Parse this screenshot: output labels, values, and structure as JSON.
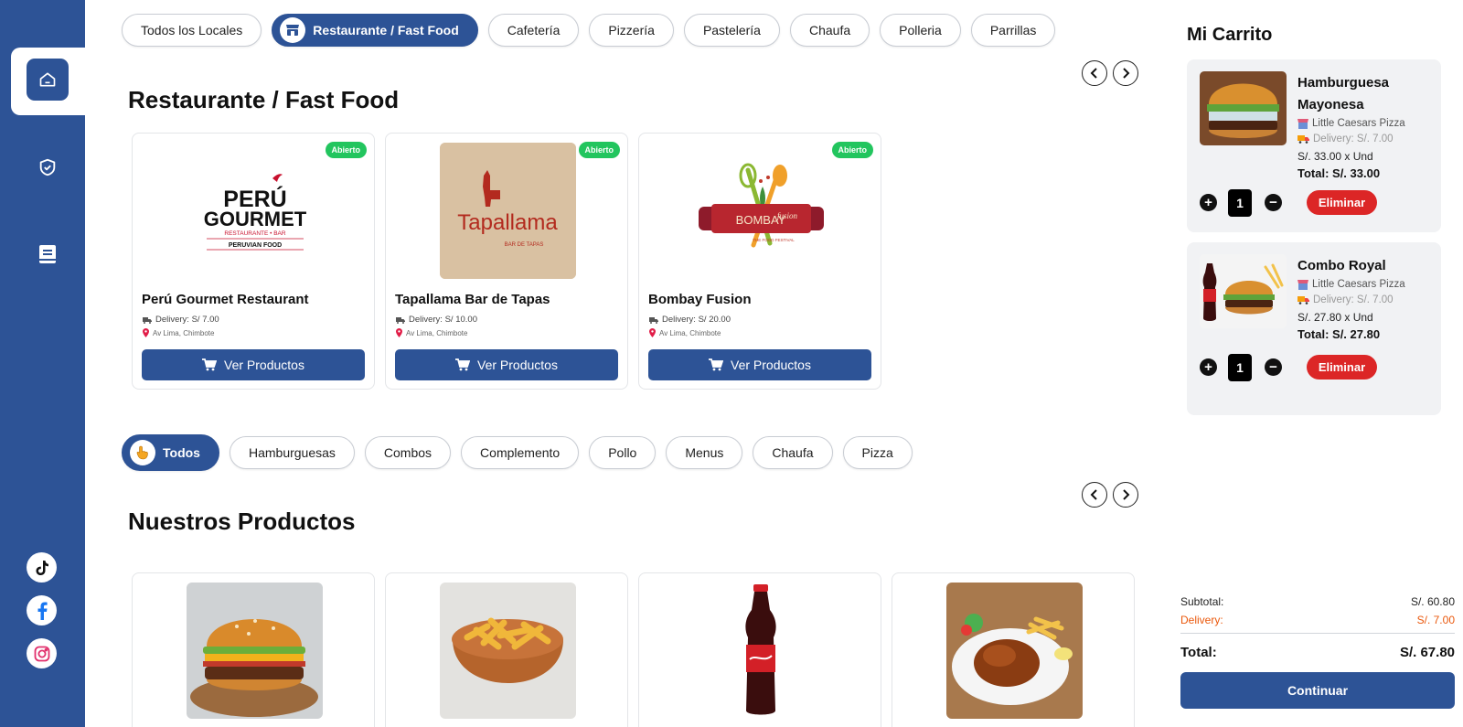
{
  "sidebar": {
    "nav": [
      {
        "icon": "home-icon"
      },
      {
        "icon": "shield-check-icon"
      },
      {
        "icon": "book-icon"
      }
    ],
    "social": [
      {
        "icon": "tiktok-icon"
      },
      {
        "icon": "facebook-icon",
        "color": "#1877f2"
      },
      {
        "icon": "instagram-icon",
        "color": "#e1306c"
      }
    ]
  },
  "store_filters": {
    "items": [
      "Todos los Locales",
      "Restaurante / Fast Food",
      "Cafetería",
      "Pizzería",
      "Pastelería",
      "Chaufa",
      "Polleria",
      "Parrillas"
    ],
    "active_index": 1
  },
  "stores_section": {
    "title": "Restaurante / Fast Food",
    "cards": [
      {
        "name": "Perú Gourmet Restaurant",
        "delivery": "Delivery: S/ 7.00",
        "address": "Av Lima, Chimbote",
        "status": "Abierto",
        "button": "Ver Productos",
        "logo": {
          "line1": "PERÚ",
          "line2": "GOURMET",
          "line3": "RESTAURANTE • BAR",
          "line4": "PERUVIAN FOOD"
        }
      },
      {
        "name": "Tapallama Bar de Tapas",
        "delivery": "Delivery: S/ 10.00",
        "address": "Av Lima, Chimbote",
        "status": "Abierto",
        "button": "Ver Productos",
        "logo": {
          "line1": "Tapallama",
          "line2": "BAR DE TAPAS"
        }
      },
      {
        "name": "Bombay Fusion",
        "delivery": "Delivery: S/ 20.00",
        "address": "Av Lima, Chimbote",
        "status": "Abierto",
        "button": "Ver Productos",
        "logo": {
          "line1": "BOMBAY",
          "line2": "fusion",
          "line3": "THE FOOD FESTIVAL"
        }
      }
    ]
  },
  "product_filters": {
    "items": [
      "Todos",
      "Hamburguesas",
      "Combos",
      "Complemento",
      "Pollo",
      "Menus",
      "Chaufa",
      "Pizza"
    ],
    "active_index": 0
  },
  "products_section": {
    "title": "Nuestros Productos",
    "cards": [
      {
        "image": "burger"
      },
      {
        "image": "fries"
      },
      {
        "image": "soda-bottle"
      },
      {
        "image": "roast-chicken"
      }
    ]
  },
  "cart": {
    "title": "Mi Carrito",
    "items": [
      {
        "name": "Hamburguesa Mayonesa",
        "store": "Little Caesars Pizza",
        "delivery": "Delivery: S/. 7.00",
        "unit_price": "S/. 33.00 x Und",
        "total": "Total: S/. 33.00",
        "qty": "1",
        "remove": "Eliminar"
      },
      {
        "name": "Combo Royal",
        "store": "Little Caesars Pizza",
        "delivery": "Delivery: S/. 7.00",
        "unit_price": "S/. 27.80 x Und",
        "total": "Total: S/. 27.80",
        "qty": "1",
        "remove": "Eliminar"
      }
    ],
    "summary": {
      "subtotal_label": "Subtotal:",
      "subtotal": "S/. 60.80",
      "delivery_label": "Delivery:",
      "delivery": "S/. 7.00",
      "total_label": "Total:",
      "total": "S/. 67.80",
      "continue": "Continuar"
    }
  },
  "colors": {
    "primary": "#2d5396",
    "open": "#22c55e",
    "danger": "#dc2626",
    "delivery": "#ea580c"
  }
}
